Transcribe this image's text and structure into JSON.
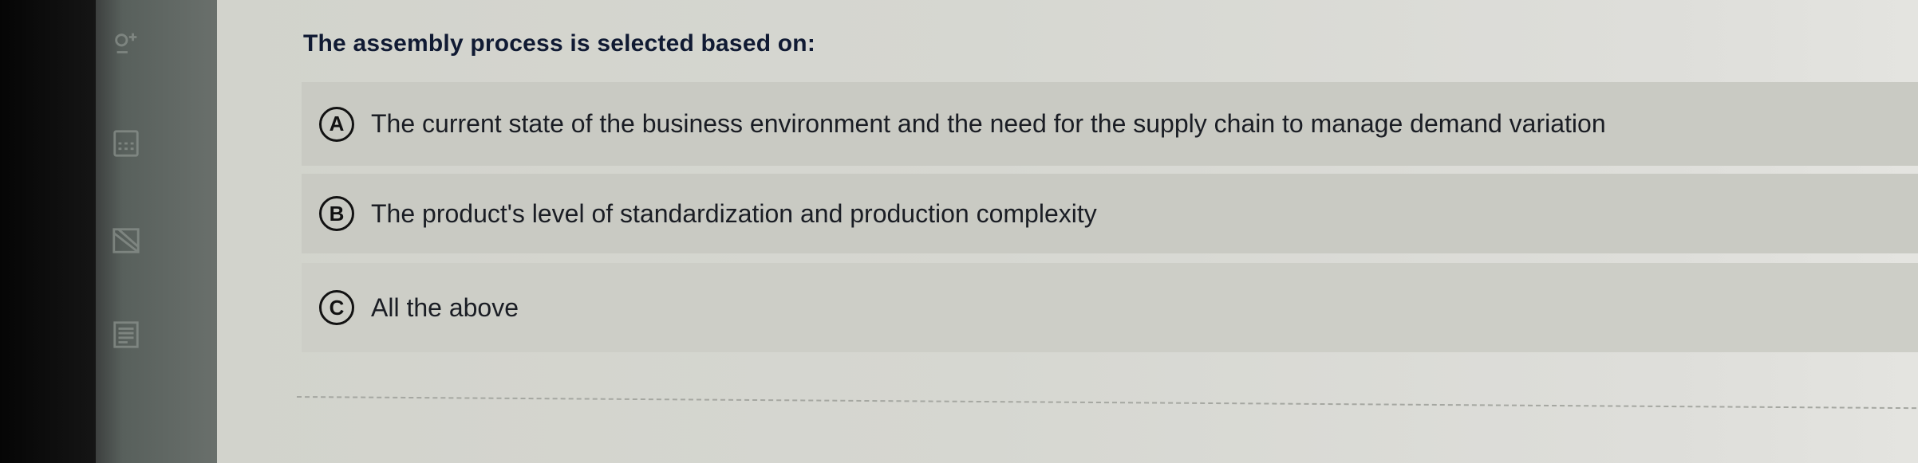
{
  "question": {
    "text": "The assembly process is selected based on:"
  },
  "options": [
    {
      "letter": "A",
      "text": "The current state of the business environment and the need for the supply chain to manage demand variation"
    },
    {
      "letter": "B",
      "text": "The product's level of standardization and production complexity"
    },
    {
      "letter": "C",
      "text": "All the above"
    }
  ],
  "sidebar": {
    "icons": [
      "calculator-icon",
      "calculator-icon",
      "image-icon",
      "notes-icon"
    ]
  }
}
